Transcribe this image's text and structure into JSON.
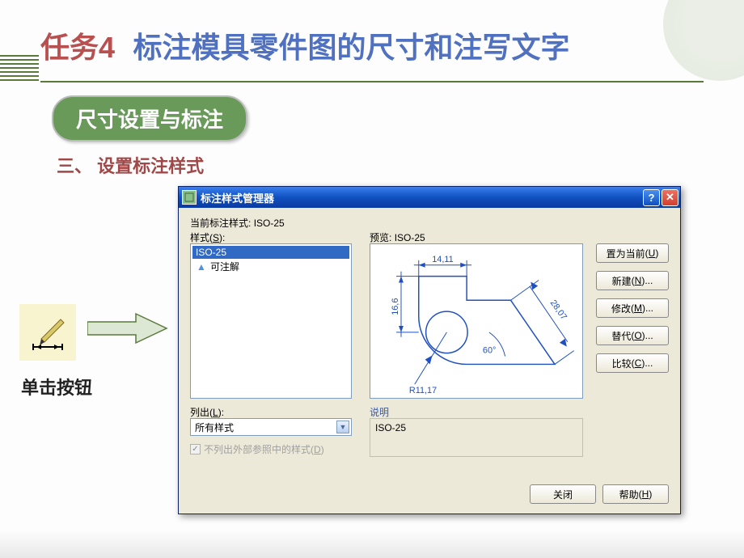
{
  "header": {
    "task": "任务4",
    "title": "标注模具零件图的尺寸和注写文字"
  },
  "pill": "尺寸设置与标注",
  "subheading": "三、 设置标注样式",
  "click_label": "单击按钮",
  "dialog": {
    "title": "标注样式管理器",
    "current_label": "当前标注样式:",
    "current_value": "ISO-25",
    "styles_label": "样式",
    "styles_key": "S",
    "styles": [
      {
        "name": "ISO-25",
        "selected": true,
        "icon": null
      },
      {
        "name": "可注解",
        "selected": false,
        "icon": "A"
      }
    ],
    "list_label": "列出",
    "list_key": "L",
    "list_value": "所有样式",
    "checkbox_label": "不列出外部参照中的样式",
    "checkbox_key": "D",
    "checkbox_checked": true,
    "preview_label": "预览:",
    "preview_value": "ISO-25",
    "desc_label": "说明",
    "desc_value": "ISO-25",
    "buttons": {
      "set_current": "置为当前",
      "set_current_key": "U",
      "new": "新建",
      "new_key": "N",
      "modify": "修改",
      "modify_key": "M",
      "override": "替代",
      "override_key": "O",
      "compare": "比较",
      "compare_key": "C",
      "close": "关闭",
      "help": "帮助",
      "help_key": "H"
    },
    "preview_dims": {
      "top": "14,11",
      "left": "16,6",
      "radius": "R11,17",
      "angle": "60°",
      "diag": "28,07"
    }
  }
}
